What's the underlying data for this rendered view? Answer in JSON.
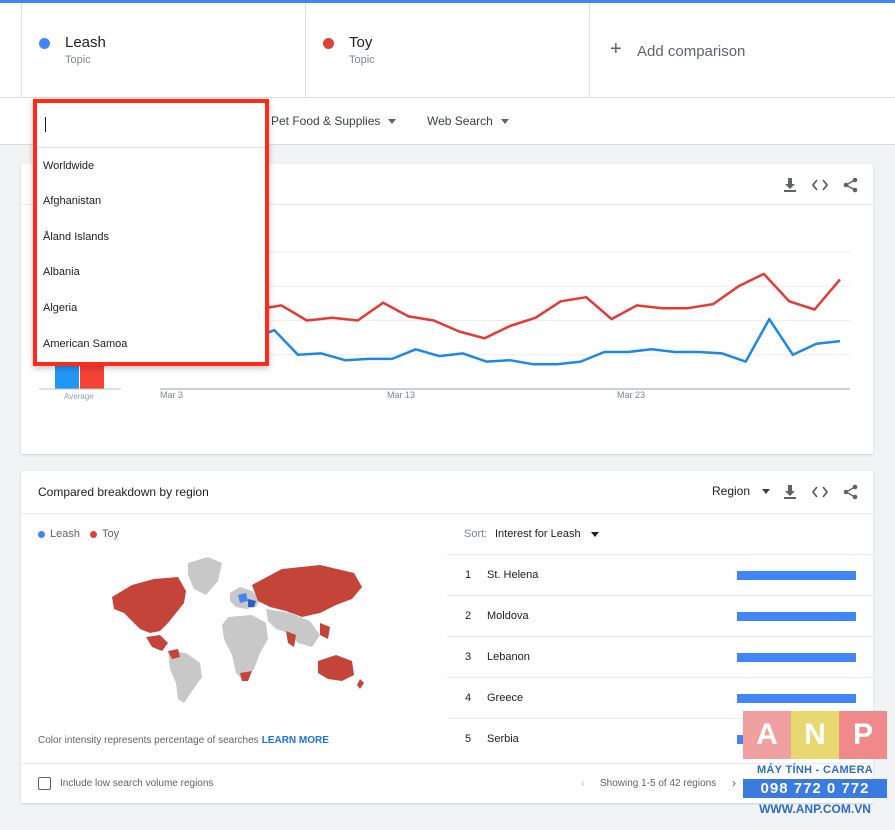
{
  "colors": {
    "leash": "#4285f4",
    "toy": "#db4437",
    "highlight": "#ff2a1a"
  },
  "terms": [
    {
      "name": "Leash",
      "type": "Topic"
    },
    {
      "name": "Toy",
      "type": "Topic"
    }
  ],
  "add_comparison": "Add comparison",
  "filters": {
    "category": "Pet Food & Supplies",
    "search_type": "Web Search"
  },
  "country_dropdown": {
    "query": "",
    "items": [
      "Worldwide",
      "Afghanistan",
      "Åland Islands",
      "Albania",
      "Algeria",
      "American Samoa"
    ]
  },
  "chart_data": {
    "type": "line",
    "x_tick_labels": [
      "Mar 3",
      "Mar 13",
      "Mar 23"
    ],
    "average_label": "Average",
    "ylim": [
      0,
      100
    ],
    "grid": true,
    "series": [
      {
        "name": "Leash",
        "values": [
          40,
          45,
          38,
          36,
          43,
          25,
          26,
          21,
          22,
          22,
          29,
          24,
          26,
          20,
          21,
          18,
          18,
          20,
          27,
          27,
          29,
          27,
          27,
          26,
          20,
          51,
          25,
          33,
          35
        ]
      },
      {
        "name": "Toy",
        "values": [
          60,
          68,
          78,
          58,
          61,
          50,
          52,
          50,
          63,
          53,
          50,
          42,
          37,
          46,
          52,
          64,
          67,
          51,
          61,
          59,
          59,
          62,
          75,
          84,
          64,
          58,
          80
        ]
      }
    ],
    "average_values": {
      "Leash": 30,
      "Toy": 30
    }
  },
  "region": {
    "title": "Compared breakdown by region",
    "level": "Region",
    "legend": [
      "Leash",
      "Toy"
    ],
    "sort_label": "Sort:",
    "sort_value": "Interest for Leash",
    "rows": [
      {
        "rank": "1",
        "name": "St. Helena",
        "value": 100
      },
      {
        "rank": "2",
        "name": "Moldova",
        "value": 100
      },
      {
        "rank": "3",
        "name": "Lebanon",
        "value": 100
      },
      {
        "rank": "4",
        "name": "Greece",
        "value": 100
      },
      {
        "rank": "5",
        "name": "Serbia",
        "value": 100
      }
    ],
    "caption": "Color intensity represents percentage of searches",
    "learn_more": "LEARN MORE",
    "low_volume_label": "Include low search volume regions",
    "pager": "Showing 1-5 of 42 regions"
  },
  "watermark": {
    "letters": [
      "A",
      "N",
      "P"
    ],
    "tagline": "MÁY TÍNH - CAMERA",
    "phone": "098 772 0 772",
    "site": "WWW.ANP.COM.VN"
  }
}
